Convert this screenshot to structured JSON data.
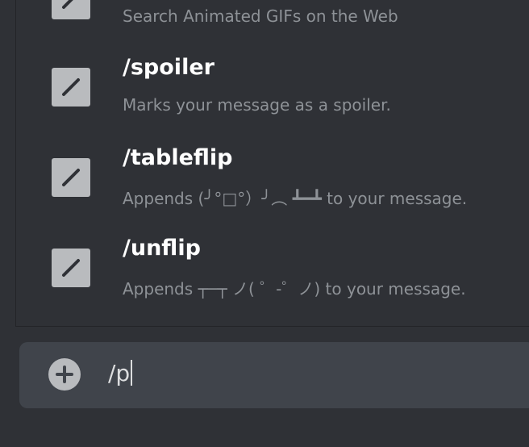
{
  "commands": [
    {
      "name": "",
      "description": "Search Animated GIFs on the Web",
      "icon": "pencil-icon"
    },
    {
      "name": "/spoiler",
      "description": "Marks your message as a spoiler.",
      "icon": "pencil-icon"
    },
    {
      "name": "/tableflip",
      "description": "Appends (╯°□°）╯︵ ┻━┻ to your message.",
      "icon": "pencil-icon"
    },
    {
      "name": "/unflip",
      "description": "Appends ┬─┬ ノ( ゜-゜ノ) to your message.",
      "icon": "pencil-icon"
    }
  ],
  "composer": {
    "add_icon": "plus-circle-icon",
    "value": "/p"
  },
  "colors": {
    "background": "#2f3136",
    "icon": "#b9bbbe",
    "input": "#40444b",
    "name": "#ffffff",
    "description": "#8e9297"
  }
}
